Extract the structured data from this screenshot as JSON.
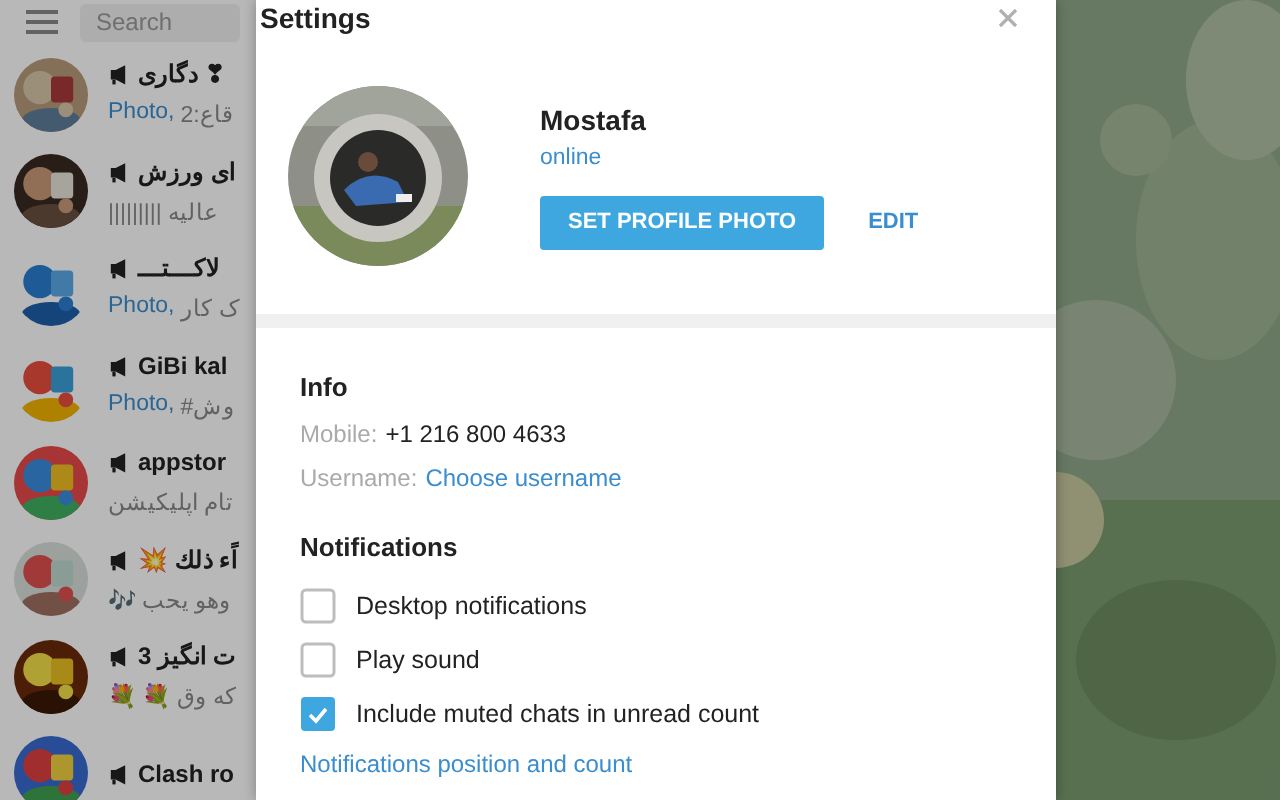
{
  "sidebar": {
    "search": {
      "placeholder": "Search"
    },
    "chats": [
      {
        "title": "دگاری ❣",
        "media": "Photo,",
        "preview": "2:قاع"
      },
      {
        "title": "ای ورزش",
        "preview": "||||||||| عالیه"
      },
      {
        "title": "لاکـــتـــ",
        "media": "Photo,",
        "preview": "ک کار"
      },
      {
        "title": "GiBi kal",
        "media": "Photo,",
        "preview": "#وش"
      },
      {
        "title": "appstor",
        "preview": "تام اپلیکیشن"
      },
      {
        "title": "💥 اًء ذلك",
        "preview": "🎶 وهو یحب"
      },
      {
        "title": "ت انگیز 3",
        "preview": "💐 💐 که وق"
      },
      {
        "title": "Clash ro"
      }
    ]
  },
  "dialog": {
    "title": "Settings",
    "profile": {
      "name": "Mostafa",
      "status": "online",
      "set_photo_button": "SET PROFILE PHOTO",
      "edit_button": "EDIT"
    },
    "info": {
      "heading": "Info",
      "fields": [
        {
          "label": "Mobile:",
          "value": "+1 216 800 4633",
          "kind": "text"
        },
        {
          "label": "Username:",
          "value": "Choose username",
          "kind": "link"
        }
      ]
    },
    "notifications": {
      "heading": "Notifications",
      "options": [
        {
          "label": "Desktop notifications",
          "checked": false
        },
        {
          "label": "Play sound",
          "checked": false
        },
        {
          "label": "Include muted chats in unread count",
          "checked": true
        }
      ],
      "link": "Notifications position and count"
    }
  }
}
